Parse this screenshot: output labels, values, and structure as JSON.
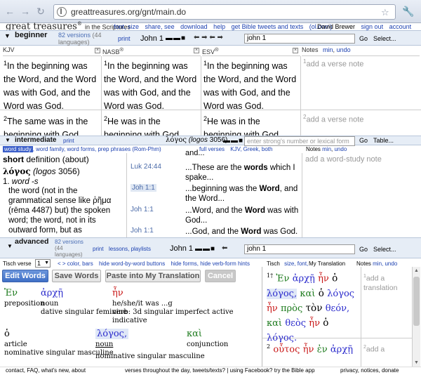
{
  "browser": {
    "url": "greattreasures.org/gnt/main.do"
  },
  "header": {
    "logo": "great treasures",
    "logo_reg": "®",
    "logo_suffix": "in the Scriptures",
    "links": [
      "font, size",
      "share, see",
      "download",
      "help",
      "get Bible tweets and texts",
      "(ol.com)"
    ],
    "user": "David Brewer",
    "sign_out": "sign out",
    "account": "account"
  },
  "beginner": {
    "level": "beginner",
    "versions": "82 versions",
    "versions_count": "(44",
    "languages": "languages)",
    "print": "print",
    "passage_label": "John 1",
    "passage_value": "john 1",
    "go": "Go",
    "select": "Select..."
  },
  "columns": [
    {
      "name": "KJV",
      "verse1": "In the beginning was the Word, and the Word was with God, and the Word was God.",
      "verse2": "The same was in the beginning with God."
    },
    {
      "name": "NASB",
      "reg": "®",
      "verse1": "In the beginning was the Word, and the Word was with God, and the Word was God.",
      "verse2": "He was in the beginning with God."
    },
    {
      "name": "ESV",
      "reg": "®",
      "verse1": "In the beginning was the Word, and the Word was with God, and the Word was God.",
      "verse2": "He was in the beginning with God."
    }
  ],
  "notes": {
    "label": "Notes",
    "min": "min",
    "undo": "undo",
    "placeholder": "add a verse note"
  },
  "verse_nums": [
    "1",
    "2"
  ],
  "intermediate": {
    "level": "intermediate",
    "print": "print",
    "word": "λόγος",
    "translit": "(logos",
    "strongs": "3056)",
    "strongs_placeholder": "enter strong's number or lexical form",
    "go": "Go",
    "table": "Table..."
  },
  "wordstudy": {
    "tabs": [
      "word study",
      "word family",
      "word forms",
      "prep phrases (Rom-Phm)"
    ],
    "right_links": [
      "full verses",
      "KJV, Greek, both"
    ],
    "notes": "Notes",
    "min": "min",
    "undo": "undo",
    "title_bold": "short",
    "title_rest": "definition (about)",
    "lemma": "λόγος",
    "lemma_translit": "(logos",
    "lemma_num": "3056)",
    "def_num": "1.",
    "def_word": "word -s",
    "def_text": "the word (not in the grammatical sense like ῥῆμα (rēma 4487) but) the spoken word; the word, not in its outward form, but as",
    "occurrences": [
      {
        "ref": "Luk 24:44",
        "pre": "...These are the ",
        "bold": "words",
        "post": " which I spake..."
      },
      {
        "ref": "Joh 1:1",
        "pre": "...beginning was the ",
        "bold": "Word",
        "post": ", and the Word..."
      },
      {
        "ref": "Joh 1:1",
        "pre": "...Word, and the ",
        "bold": "Word",
        "post": " was with God..."
      },
      {
        "ref": "Joh 1:1",
        "pre": "...God, and the ",
        "bold": "Word",
        "post": " was God."
      }
    ],
    "prev_fragment": "and...",
    "note_placeholder": "add a word-study note"
  },
  "advanced": {
    "level": "advanced",
    "versions": "82 versions",
    "versions_count": "(44",
    "languages": "languages)",
    "print": "print",
    "lessons": "lessons, playlists",
    "passage_label": "John 1",
    "passage_value": "john 1",
    "go": "Go",
    "select": "Select..."
  },
  "tisch": {
    "label": "Tisch verse",
    "verse": "1",
    "links": [
      "< > color, bars",
      "hide word-by-word buttons",
      "hide forms, hide verb-form hints"
    ],
    "right_label": "Tisch",
    "right_links": "size, font, hide",
    "my_translation": "My Translation",
    "notes": "Notes",
    "min": "min, undo"
  },
  "buttons": {
    "edit": "Edit Words",
    "save": "Save Words",
    "paste": "Paste into My Translation",
    "cancel": "Cancel"
  },
  "interlinear": [
    {
      "gk": "Ἐν",
      "cls": "gk-g",
      "gloss": "preposition",
      "parse": ""
    },
    {
      "gk": "ἀρχῇ",
      "cls": "gk",
      "gloss": "noun",
      "parse": "dative singular feminine"
    },
    {
      "gk": "ἦν",
      "cls": "gk-r",
      "gloss": "he/she/it was ...g",
      "parse": "verb: 3d singular imperfect active indicative"
    },
    {
      "gk": "ὁ",
      "cls": "gk-b",
      "gloss": "article",
      "parse": "nominative singular masculine"
    },
    {
      "gk": "λόγος,",
      "cls": "gk",
      "gloss": "noun",
      "parse": "nominative singular masculine"
    },
    {
      "gk": "καὶ",
      "cls": "gk-g",
      "gloss": "conjunction",
      "parse": ""
    }
  ],
  "translation": {
    "v1_num": "1",
    "v1_mark": "†",
    "v1": [
      "Ἐν",
      "ἀρχῇ",
      "ἦν",
      "ὁ",
      "λόγος,",
      "καὶ",
      "ὁ",
      "λόγος",
      "ἦν",
      "πρὸς",
      "τὸν",
      "θεόν,",
      "καὶ",
      "θεὸς",
      "ἦν",
      "ὁ",
      "λόγος."
    ],
    "v2_num": "2",
    "v2": [
      "οὗτος",
      "ἦν",
      "ἐν",
      "ἀρχῇ"
    ],
    "note1": "add a translation",
    "note2": "add a"
  },
  "footer": {
    "left": "contact, FAQ, what's new, about",
    "middle": "verses throughout the day, tweets/texts? | using Facebook? try the Bible app",
    "right": "privacy, notices, donate"
  },
  "colors": {
    "accent": "#3a5ec9",
    "link": "#1a3fb0",
    "bar": "#e6edf6",
    "greek_blue": "#2a2acc",
    "greek_red": "#c81818",
    "greek_green": "#1c7a1c"
  }
}
